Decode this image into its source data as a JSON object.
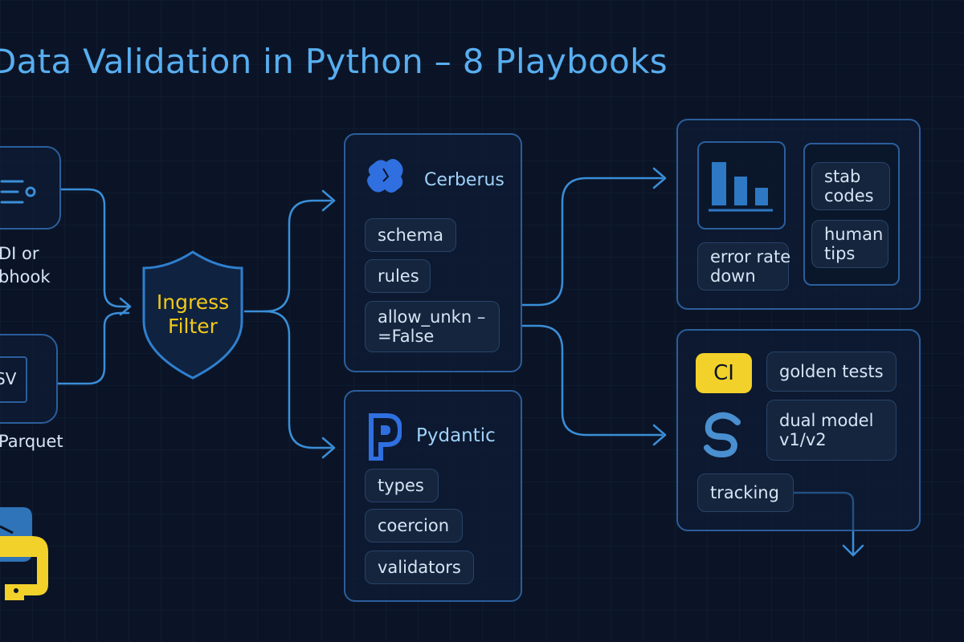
{
  "title": "Data Validation in Python – 8 Playbooks",
  "sources": {
    "api_label": "DI or\nbhook",
    "file_icon_label": "SV",
    "file_label": "Parquet"
  },
  "filter": {
    "label": "Ingress\nFilter"
  },
  "cerberus": {
    "name": "Cerberus",
    "chips": [
      "schema",
      "rules",
      "allow_unkn –\n=False"
    ]
  },
  "pydantic": {
    "name": "Pydantic",
    "chips": [
      "types",
      "coercion",
      "validators"
    ]
  },
  "metrics": {
    "error_chip": "error rate\ndown",
    "chips": [
      "stab\ncodes",
      "human\ntips"
    ]
  },
  "ci_panel": {
    "ci_badge": "CI",
    "chips": [
      "golden tests",
      "dual model\nv1/v2",
      "tracking"
    ]
  },
  "colors": {
    "accent": "#58aef0",
    "border": "#2b5e9c",
    "highlight": "#f2d12a"
  }
}
